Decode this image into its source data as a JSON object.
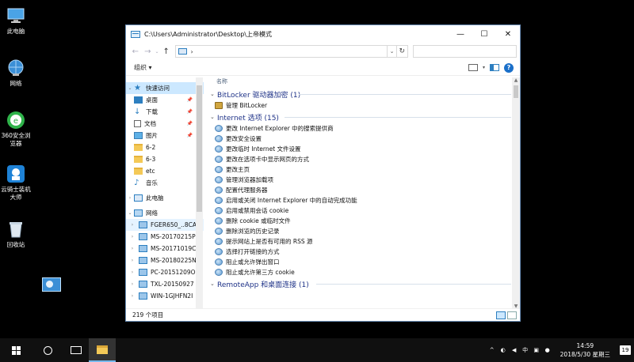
{
  "desktop": {
    "icons": [
      {
        "label": "此电脑"
      },
      {
        "label": "网络"
      },
      {
        "label": "360安全浏览器"
      },
      {
        "label": "云骑士装机大师"
      },
      {
        "label": "回收站"
      }
    ]
  },
  "window": {
    "title": "C:\\Users\\Administrator\\Desktop\\上帝模式",
    "controls": {
      "minimize": "—",
      "maximize": "☐",
      "close": "✕"
    },
    "address": {
      "arrow": "›",
      "dropdown": "⌄",
      "refresh": "↻"
    },
    "toolbar": {
      "organize": "组织 ▾",
      "help": "?"
    }
  },
  "nav": {
    "quick_access": "快速访问",
    "items": [
      {
        "label": "桌面",
        "pinned": true
      },
      {
        "label": "下载",
        "pinned": true
      },
      {
        "label": "文档",
        "pinned": true
      },
      {
        "label": "图片",
        "pinned": true
      },
      {
        "label": "6-2"
      },
      {
        "label": "6-3"
      },
      {
        "label": "etc"
      },
      {
        "label": "音乐"
      }
    ],
    "this_pc": "此电脑",
    "network": "网络",
    "network_items": [
      {
        "label": "FGER650_..8CA"
      },
      {
        "label": "MS-20170215P"
      },
      {
        "label": "MS-20171019C"
      },
      {
        "label": "MS-20180225N"
      },
      {
        "label": "PC-20151209O"
      },
      {
        "label": "TXL-20150927"
      },
      {
        "label": "WIN-1GJHFN2I"
      }
    ]
  },
  "content": {
    "column_name": "名称",
    "groups": [
      {
        "title": "BitLocker 驱动器加密 (1)",
        "items": [
          "管理 BitLocker"
        ]
      },
      {
        "title": "Internet 选项 (15)",
        "items": [
          "更改 Internet Explorer 中的搜索提供商",
          "更改安全设置",
          "更改临时 Internet 文件设置",
          "更改在选项卡中显示网页的方式",
          "更改主页",
          "管理浏览器加载项",
          "配置代理服务器",
          "启用或关闭 Internet Explorer 中的自动完成功能",
          "启用或禁用会话 cookie",
          "删除 cookie 或临时文件",
          "删除浏览的历史记录",
          "提示网站上是否有可用的 RSS 源",
          "选择打开链接的方式",
          "阻止或允许弹出窗口",
          "阻止或允许第三方 cookie"
        ]
      },
      {
        "title": "RemoteApp 和桌面连接 (1)",
        "items": []
      }
    ]
  },
  "status": {
    "count": "219 个项目"
  },
  "taskbar": {
    "time": "14:59",
    "date": "2018/5/30 星期三",
    "ime": "中",
    "notifications": "19"
  },
  "colors": {
    "group_title": "#1e3287",
    "selected": "#cce8ff",
    "accent": "#2d7fc0"
  }
}
